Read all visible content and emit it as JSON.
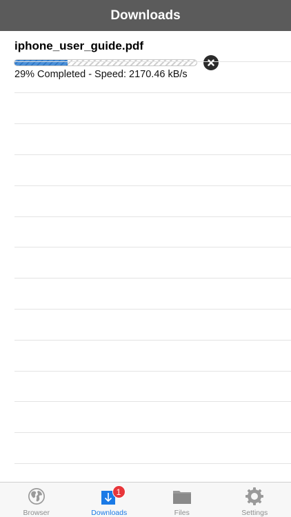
{
  "header": {
    "title": "Downloads"
  },
  "download": {
    "file_name": "iphone_user_guide.pdf",
    "progress": 0.29,
    "status": "29% Completed - Speed: 2170.46 kB/s"
  },
  "tabs": [
    {
      "label": "Browser",
      "icon": "globe-icon",
      "active": false
    },
    {
      "label": "Downloads",
      "icon": "download-icon",
      "active": true,
      "badge": "1"
    },
    {
      "label": "Files",
      "icon": "folder-icon",
      "active": false
    },
    {
      "label": "Settings",
      "icon": "gear-icon",
      "active": false
    }
  ],
  "colors": {
    "nav_bar": "#5b5b5b",
    "accent": "#1a7ae6",
    "badge": "#e8363a",
    "progress": "#3a83d2"
  }
}
